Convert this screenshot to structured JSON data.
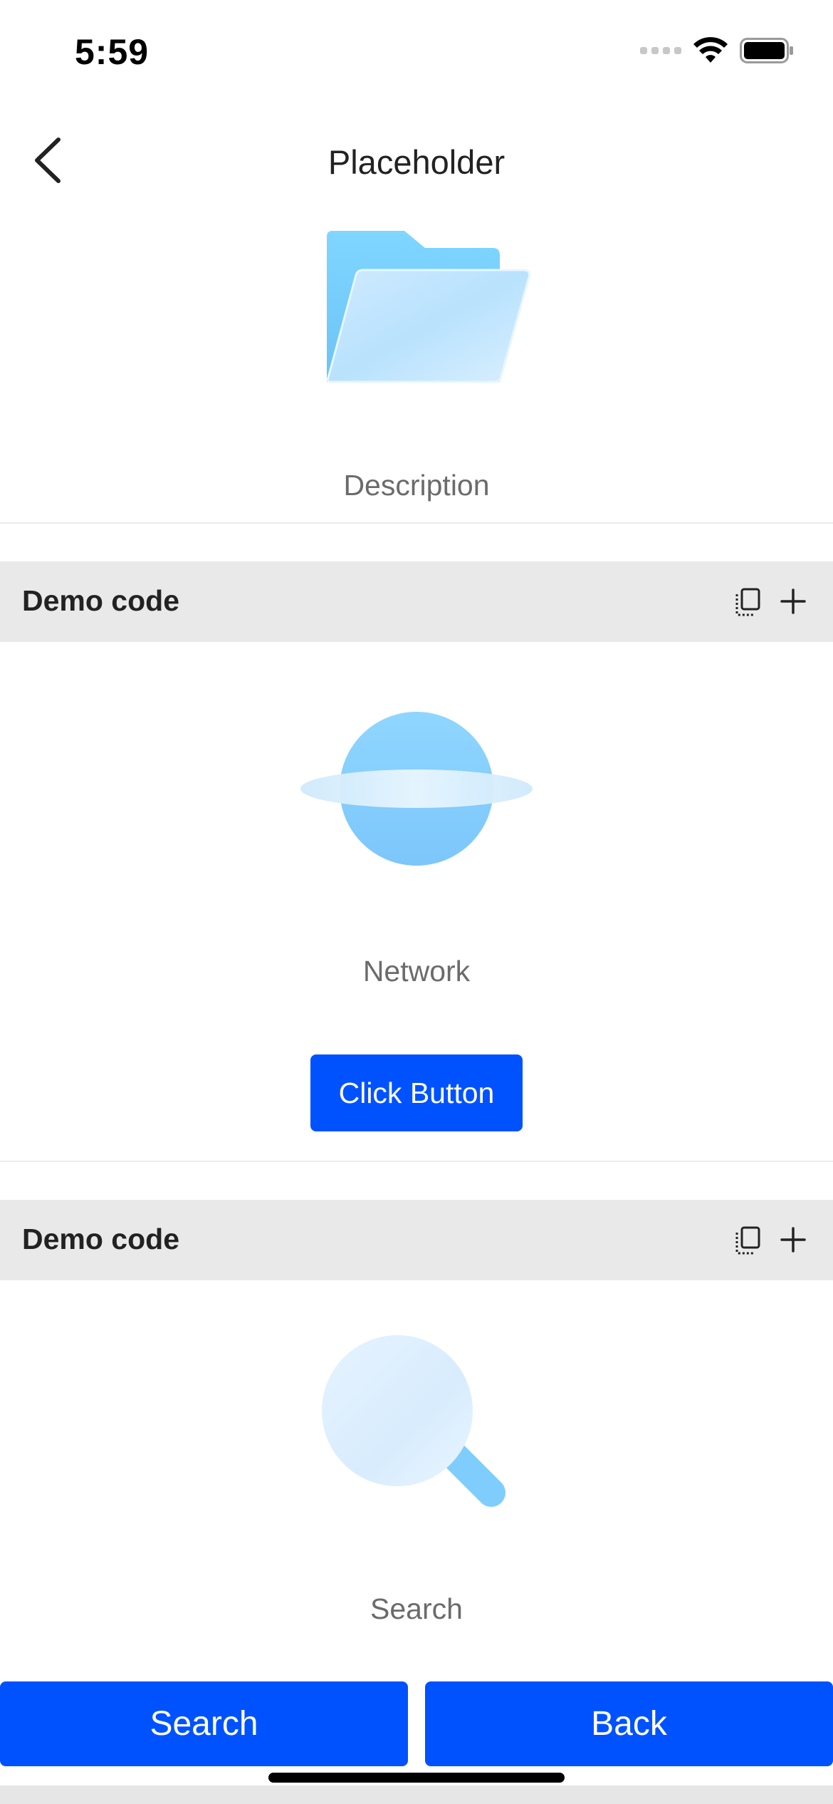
{
  "status_bar": {
    "time": "5:59"
  },
  "nav": {
    "title": "Placeholder",
    "back_icon": "chevron-left-icon"
  },
  "folder_section": {
    "icon": "folder-icon",
    "caption": "Description"
  },
  "demo_sections": [
    {
      "title": "Demo code",
      "copy_icon": "copy-icon",
      "add_icon": "plus-icon"
    },
    {
      "title": "Demo code",
      "copy_icon": "copy-icon",
      "add_icon": "plus-icon"
    }
  ],
  "network_section": {
    "icon": "network-planet-icon",
    "caption": "Network",
    "button_label": "Click Button"
  },
  "search_section": {
    "icon": "magnifier-icon",
    "caption": "Search"
  },
  "bottom_bar": {
    "search_label": "Search",
    "back_label": "Back"
  },
  "colors": {
    "primary": "#0052ff",
    "header_bg": "#e9e9e9",
    "illustration_blue": "#7fcdfc"
  }
}
